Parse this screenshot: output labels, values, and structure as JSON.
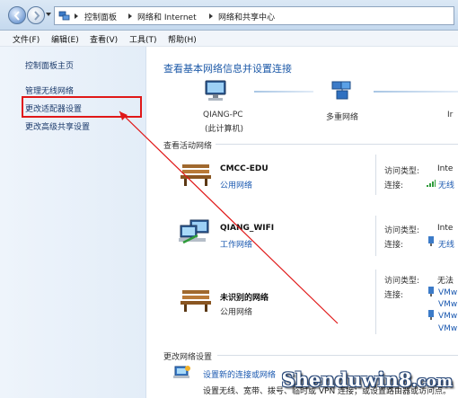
{
  "address_bar": {
    "crumbs": [
      "控制面板",
      "网络和 Internet",
      "网络和共享中心"
    ]
  },
  "menubar": [
    "文件(F)",
    "编辑(E)",
    "查看(V)",
    "工具(T)",
    "帮助(H)"
  ],
  "left_pane": {
    "links": [
      "控制面板主页",
      "管理无线网络",
      "更改适配器设置",
      "更改高级共享设置"
    ],
    "highlighted": "更改适配器设置"
  },
  "main": {
    "title": "查看基本网络信息并设置连接",
    "map": {
      "computer_name": "QIANG-PC",
      "computer_sub": "(此计算机)",
      "middle": "多重网络",
      "right": "Ir"
    },
    "active_section": "查看活动网络",
    "networks": [
      {
        "name": "CMCC-EDU",
        "type": "公用网络",
        "type_link": true,
        "access_label": "访问类型:",
        "access_value": "Inte",
        "conn_label": "连接:",
        "conn_value": [
          "无线"
        ]
      },
      {
        "name": "QIANG_WIFI",
        "type": "工作网络",
        "type_link": true,
        "access_label": "访问类型:",
        "access_value": "Inte",
        "conn_label": "连接:",
        "conn_value": [
          "无线"
        ]
      },
      {
        "name": "未识别的网络",
        "type": "公用网络",
        "type_link": false,
        "access_label": "访问类型:",
        "access_value": "无法",
        "conn_label": "连接:",
        "conn_value": [
          "VMw",
          "VMw",
          "VMw",
          "VMw"
        ]
      }
    ],
    "change_section": "更改网络设置",
    "settings": {
      "link": "设置新的连接或网络",
      "desc": "设置无线、宽带、拨号、临时或 VPN 连接；或设置路由器或访问点。"
    }
  },
  "watermark": {
    "main": "Shenduwin8",
    "suffix": ".com"
  },
  "colors": {
    "title": "#1e5aa8",
    "link": "#1b59b0",
    "highlight_box": "#e01818",
    "arrow": "#e01818"
  }
}
